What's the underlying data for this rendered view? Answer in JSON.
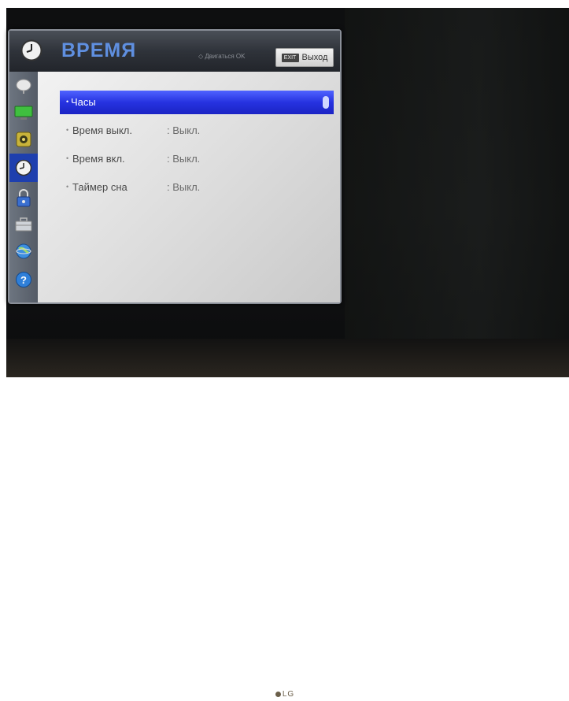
{
  "menu": {
    "title": "ВРЕМЯ",
    "hint": "◇ Двигаться  OK",
    "exit_badge": "EXIT",
    "exit_label": "Выход"
  },
  "sidebar": {
    "items": [
      {
        "icon": "satellite-dish-icon"
      },
      {
        "icon": "monitor-icon"
      },
      {
        "icon": "speaker-icon"
      },
      {
        "icon": "clock-icon",
        "active": true
      },
      {
        "icon": "lock-icon"
      },
      {
        "icon": "briefcase-icon"
      },
      {
        "icon": "globe-icon"
      },
      {
        "icon": "help-icon"
      }
    ]
  },
  "settings": {
    "rows": [
      {
        "label": "Часы",
        "value": ""
      },
      {
        "label": "Время выкл.",
        "value": ": Выкл."
      },
      {
        "label": "Время вкл.",
        "value": ": Выкл."
      },
      {
        "label": "Таймер сна",
        "value": ": Выкл."
      }
    ]
  },
  "tv": {
    "brand": "LG"
  },
  "colors": {
    "title": "#5f8fe0",
    "selection": "#2632e0",
    "panel": "#e0e0e0"
  }
}
